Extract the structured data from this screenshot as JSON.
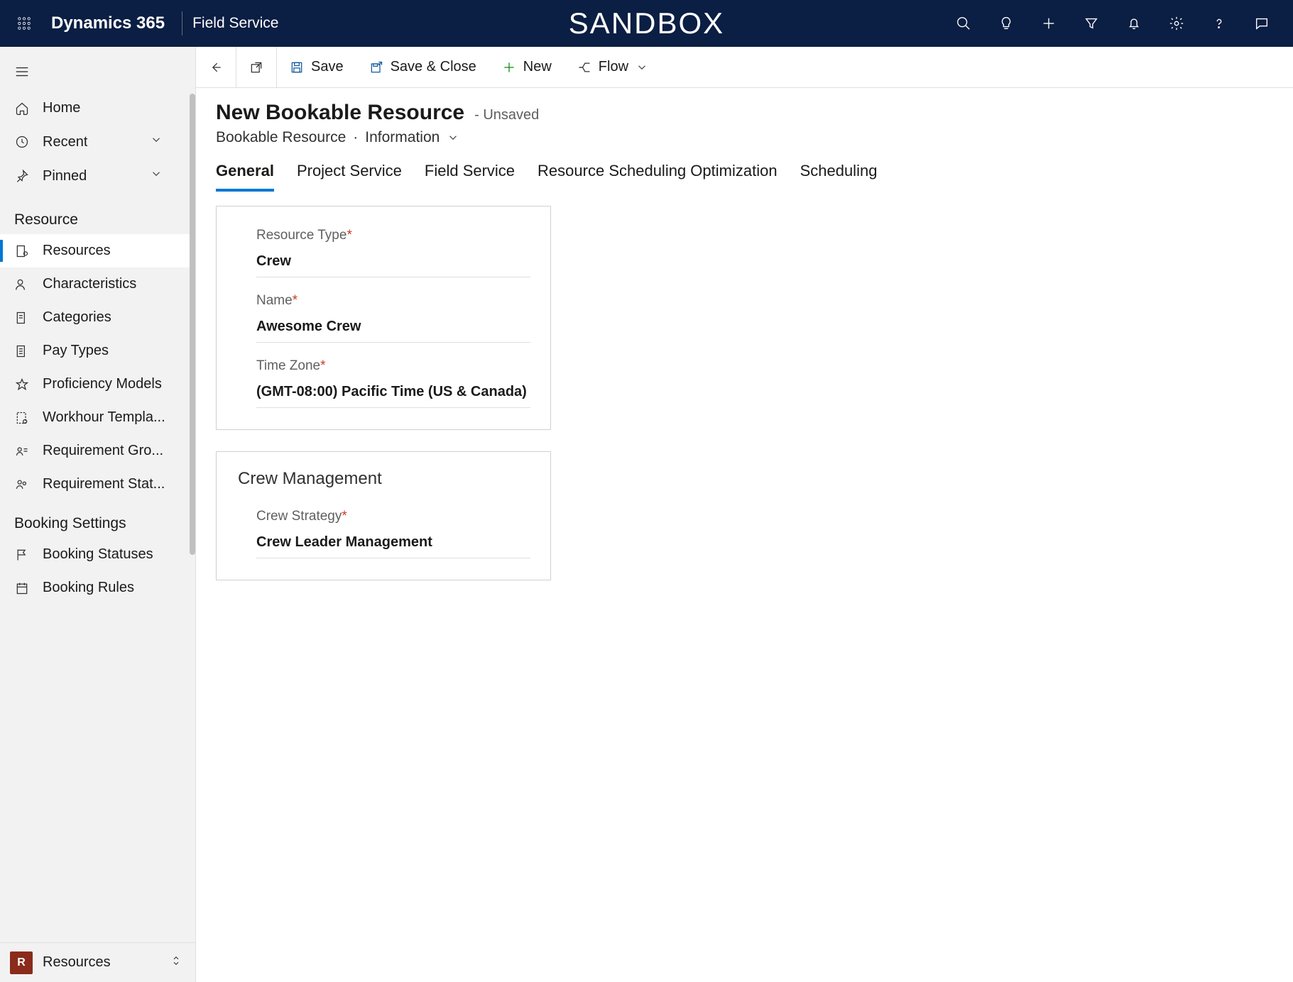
{
  "header": {
    "brand": "Dynamics 365",
    "module": "Field Service",
    "environment": "SANDBOX"
  },
  "sidebar": {
    "home": "Home",
    "recent": "Recent",
    "pinned": "Pinned",
    "section_resource": "Resource",
    "items_resource": [
      "Resources",
      "Characteristics",
      "Categories",
      "Pay Types",
      "Proficiency Models",
      "Workhour Templa...",
      "Requirement Gro...",
      "Requirement Stat..."
    ],
    "section_booking": "Booking Settings",
    "items_booking": [
      "Booking Statuses",
      "Booking Rules"
    ],
    "area_badge": "R",
    "area_label": "Resources"
  },
  "commandbar": {
    "save": "Save",
    "save_close": "Save & Close",
    "new": "New",
    "flow": "Flow"
  },
  "page": {
    "title": "New Bookable Resource",
    "status": "- Unsaved",
    "entity": "Bookable Resource",
    "sep": "·",
    "form": "Information"
  },
  "tabs": [
    "General",
    "Project Service",
    "Field Service",
    "Resource Scheduling Optimization",
    "Scheduling"
  ],
  "form1": {
    "fields": [
      {
        "label": "Resource Type",
        "value": "Crew",
        "required": true
      },
      {
        "label": "Name",
        "value": "Awesome Crew",
        "required": true
      },
      {
        "label": "Time Zone",
        "value": "(GMT-08:00) Pacific Time (US & Canada)",
        "required": true
      }
    ]
  },
  "form2": {
    "title": "Crew Management",
    "fields": [
      {
        "label": "Crew Strategy",
        "value": "Crew Leader Management",
        "required": true
      }
    ]
  }
}
